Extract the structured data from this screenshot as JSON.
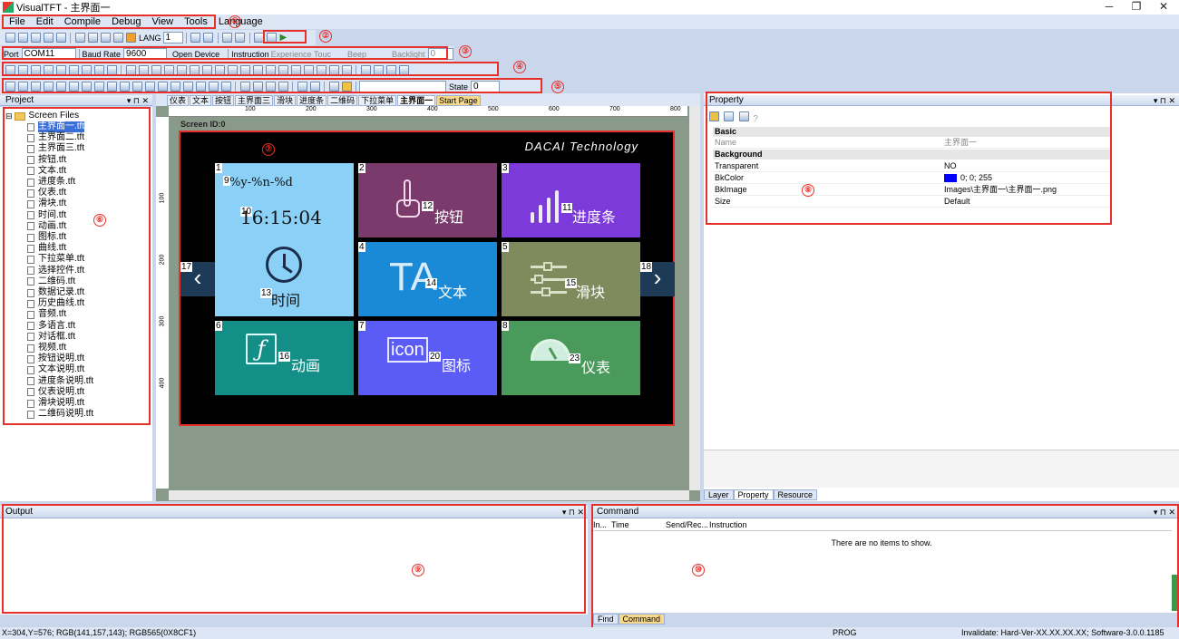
{
  "window": {
    "title": "VisualTFT - 主界面一"
  },
  "menu": [
    "File",
    "Edit",
    "Compile",
    "Debug",
    "View",
    "Tools",
    "Language"
  ],
  "toolbar2": {
    "lang_label": "LANG",
    "lang_value": "1"
  },
  "toolbar3": {
    "port_label": "Port",
    "port_value": "COM11",
    "baud_label": "Baud Rate",
    "baud_value": "9600",
    "open_device": "Open Device",
    "instruction": "Instruction",
    "experience": "Experience Touc",
    "beep": "Beep",
    "backlight": "Backlight",
    "backlight_value": "0"
  },
  "toolbar5": {
    "state_label": "State",
    "state_value": "0"
  },
  "callouts": [
    "①",
    "②",
    "③",
    "④",
    "⑤",
    "⑥",
    "⑦",
    "⑧",
    "⑨",
    "⑩"
  ],
  "project": {
    "title": "Project",
    "root": "Screen Files",
    "files": [
      "主界面一.tft",
      "主界面二.tft",
      "主界面三.tft",
      "按钮.tft",
      "文本.tft",
      "进度条.tft",
      "仪表.tft",
      "滑块.tft",
      "时间.tft",
      "动画.tft",
      "图标.tft",
      "曲线.tft",
      "下拉菜单.tft",
      "选择控件.tft",
      "二维码.tft",
      "数据记录.tft",
      "历史曲线.tft",
      "音频.tft",
      "多语言.tft",
      "对话框.tft",
      "视频.tft",
      "按钮说明.tft",
      "文本说明.tft",
      "进度条说明.tft",
      "仪表说明.tft",
      "滑块说明.tft",
      "二维码说明.tft"
    ]
  },
  "doc_tabs": [
    "仪表",
    "文本",
    "按钮",
    "主界面三",
    "滑块",
    "进度条",
    "二维码",
    "下拉菜单",
    "主界面一",
    "Start Page"
  ],
  "ruler": [
    "100",
    "200",
    "300",
    "400",
    "500",
    "600",
    "700",
    "800"
  ],
  "vruler": [
    "100",
    "200",
    "300",
    "400"
  ],
  "screen": {
    "id_label": "Screen ID:0",
    "brand": "DACAI Technology",
    "tiles": [
      {
        "num": "1",
        "label": ""
      },
      {
        "num": "2",
        "label": "按钮"
      },
      {
        "num": "3",
        "label": "进度条"
      },
      {
        "num": "4",
        "label": "文本"
      },
      {
        "num": "5",
        "label": "滑块"
      },
      {
        "num": "6",
        "label": "动画"
      },
      {
        "num": "7",
        "label": "图标"
      },
      {
        "num": "8",
        "label": "仪表"
      }
    ],
    "date_fmt": "%y-%n-%d",
    "time_val": "16:15:04",
    "time_label": "时间",
    "n9": "9",
    "n10": "10",
    "n11": "11",
    "n12": "12",
    "n13": "13",
    "n14": "14",
    "n15": "15",
    "n16": "16",
    "n17": "17",
    "n18": "18",
    "n20": "20",
    "n23": "23",
    "icon_text": "icon",
    "ta_text": "TA"
  },
  "property": {
    "title": "Property",
    "sections": [
      "Basic",
      "Background"
    ],
    "rows": [
      {
        "k": "Name",
        "v": "主界面一"
      },
      {
        "k": "Transparent",
        "v": "NO"
      },
      {
        "k": "BkColor",
        "v": "0; 0; 255"
      },
      {
        "k": "BkImage",
        "v": "Images\\主界面一\\主界面一.png"
      },
      {
        "k": "Size",
        "v": "Default"
      }
    ],
    "tabs": [
      "Layer",
      "Property",
      "Resource"
    ]
  },
  "output": {
    "title": "Output"
  },
  "command": {
    "title": "Command",
    "cols": [
      "In...",
      "Time",
      "Send/Rec...",
      "Instruction"
    ],
    "empty": "There are no items to show.",
    "tabs": [
      "Find",
      "Command"
    ]
  },
  "status": {
    "left": "X=304,Y=576; RGB(141,157,143); RGB565(0X8CF1)",
    "mid": "PROG",
    "right": "Invalidate: Hard-Ver-XX.XX.XX.XX; Software-3.0.0.1185"
  }
}
